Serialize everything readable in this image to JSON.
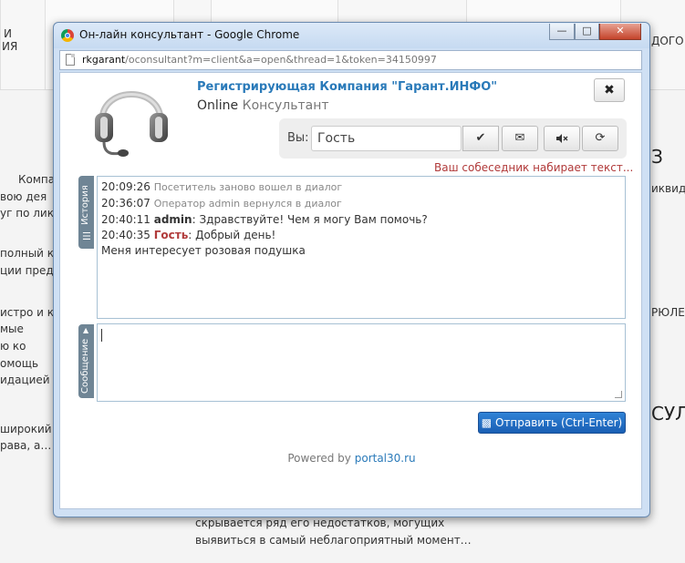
{
  "background": {
    "left_fragments": [
      "И",
      "ИЯ",
      "Компа",
      "вою  дея",
      "уг по лик",
      "полный к",
      "ции пред",
      "истро  и  к",
      "мые",
      "ю      ко",
      "омощь",
      "идацией В",
      "широкий с",
      "рава, а…"
    ],
    "right_fragments": [
      "ДОГО",
      "З",
      "иквид",
      "РЮЛЕ",
      "СУЛ"
    ],
    "bottom_lines": [
      "скрывается     ряд     его     недостатков,     могущих",
      "выявиться в самый неблагоприятный момент…"
    ]
  },
  "window": {
    "title": "Он-лайн консультант - Google Chrome",
    "buttons": {
      "minimize": "—",
      "maximize": "□",
      "close": "✕"
    },
    "url_host": "rkgarant",
    "url_path": "/oconsultant?m=client&a=open&thread=1&token=34150997"
  },
  "header": {
    "company": "Регистрирующая Компания \"Гарант.ИНФО\"",
    "status_online": "Online",
    "status_role": "Консультант",
    "close_glyph": "✖"
  },
  "toolbar": {
    "you_label": "Вы:",
    "name_value": "Гость",
    "icons": [
      "check-icon",
      "envelope-icon",
      "mute-icon",
      "refresh-icon"
    ]
  },
  "typing_indicator": "Ваш собеседник набирает текст...",
  "history": {
    "tab_label": "История",
    "messages": [
      {
        "time": "20:09:26",
        "text": "Посетитель заново вошел в диалог"
      },
      {
        "time": "20:36:07",
        "text": "Оператор admin вернулся в диалог"
      },
      {
        "time": "20:40:11",
        "author": "admin",
        "text": ": Здравствуйте! Чем я могу Вам помочь?"
      },
      {
        "time": "20:40:35",
        "author": "Гость",
        "text": ": Добрый день!"
      },
      {
        "text": "Меня интересует розовая подушка"
      }
    ]
  },
  "composer": {
    "tab_label": "Сообщение",
    "value": ""
  },
  "send_button": "Отправить (Ctrl-Enter)",
  "footer": {
    "powered_by": "Powered by",
    "link": "portal30.ru"
  },
  "colors": {
    "accent": "#2a7ab9",
    "guest": "#b13a3a",
    "send_button": "#1a5fb4"
  }
}
